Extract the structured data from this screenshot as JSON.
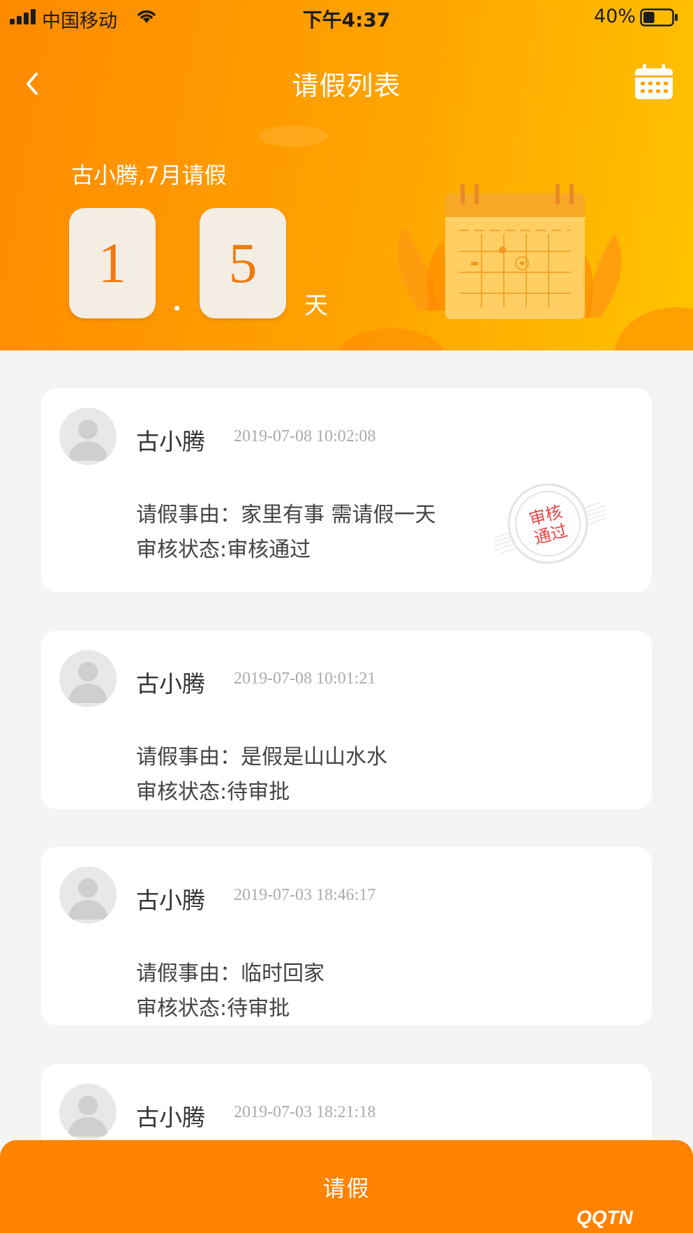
{
  "status_bar": {
    "carrier": "中国移动",
    "time": "下午4:37",
    "battery_percent": "40%",
    "battery_level": 0.4
  },
  "nav": {
    "title": "请假列表",
    "back_icon": "chevron-left-icon",
    "calendar_icon": "calendar-icon"
  },
  "summary": {
    "text": "古小腾,7月请假",
    "digit_1": "1",
    "digit_2": "5",
    "decimal": ".",
    "unit": "天"
  },
  "records": [
    {
      "name": "古小腾",
      "time": "2019-07-08 10:02:08",
      "reason": "请假事由：家里有事 需请假一天",
      "status": "审核状态:审核通过",
      "stamp": {
        "line1": "审核",
        "line2": "通过"
      }
    },
    {
      "name": "古小腾",
      "time": "2019-07-08 10:01:21",
      "reason": "请假事由：是假是山山水水",
      "status": "审核状态:待审批"
    },
    {
      "name": "古小腾",
      "time": "2019-07-03 18:46:17",
      "reason": "请假事由：临时回家",
      "status": "审核状态:待审批"
    },
    {
      "name": "古小腾",
      "time": "2019-07-03 18:21:18"
    }
  ],
  "bottom_button": {
    "label": "请假"
  },
  "watermark": "QQTN",
  "colors": {
    "accent": "#ff8200",
    "header_start": "#ff8a00",
    "header_end": "#ffc300",
    "digit": "#ec7c12",
    "stamp_red": "#e64545"
  }
}
